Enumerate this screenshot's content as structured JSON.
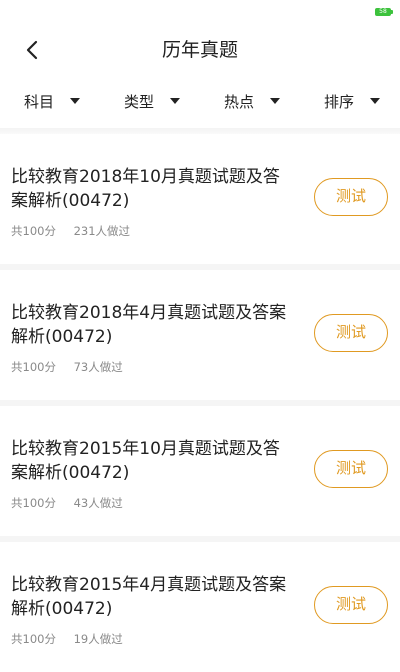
{
  "status_bar": {
    "battery": "58"
  },
  "header": {
    "title": "历年真题"
  },
  "filters": [
    {
      "label": "科目"
    },
    {
      "label": "类型"
    },
    {
      "label": "热点"
    },
    {
      "label": "排序"
    }
  ],
  "exams": [
    {
      "title": "比较教育2018年10月真题试题及答案解析(00472)",
      "score": "共100分",
      "participants": "231人做过",
      "button": "测试"
    },
    {
      "title": "比较教育2018年4月真题试题及答案解析(00472)",
      "score": "共100分",
      "participants": "73人做过",
      "button": "测试"
    },
    {
      "title": "比较教育2015年10月真题试题及答案解析(00472)",
      "score": "共100分",
      "participants": "43人做过",
      "button": "测试"
    },
    {
      "title": "比较教育2015年4月真题试题及答案解析(00472)",
      "score": "共100分",
      "participants": "19人做过",
      "button": "测试"
    }
  ],
  "colors": {
    "accent": "#e09a22",
    "battery": "#3cc23c"
  },
  "icons": {
    "back": "chevron-left-icon",
    "filter": "caret-down-icon"
  }
}
